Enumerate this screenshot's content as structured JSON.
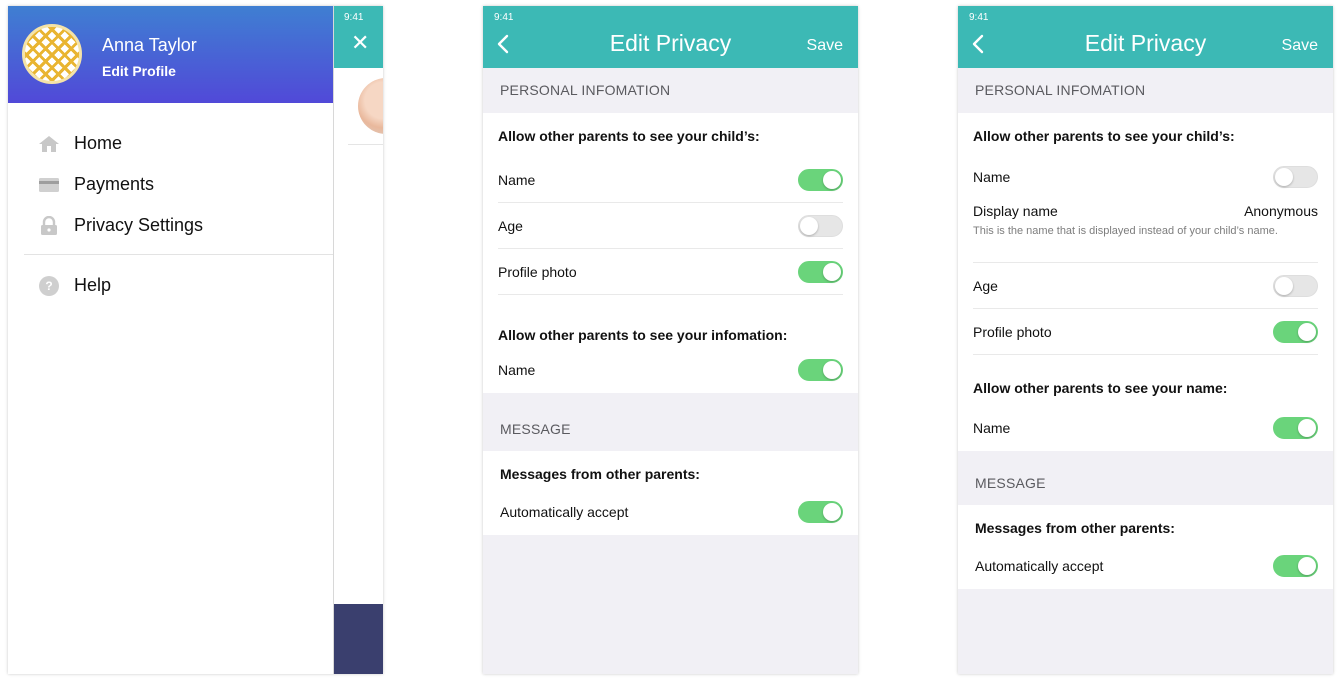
{
  "drawer_screen": {
    "status_time": "9:41",
    "user": {
      "name": "Anna Taylor",
      "edit_profile": "Edit Profile"
    },
    "menu": [
      {
        "label": "Home",
        "icon": "home-icon"
      },
      {
        "label": "Payments",
        "icon": "card-icon"
      },
      {
        "label": "Privacy Settings",
        "icon": "lock-icon"
      }
    ],
    "help": {
      "label": "Help",
      "icon": "help-icon",
      "glyph": "?"
    }
  },
  "privacy_screen_a": {
    "status_time": "9:41",
    "title": "Edit Privacy",
    "save_label": "Save",
    "personal_section": "PERSONAL INFOMATION",
    "child_subhead": "Allow other parents to see your child’s:",
    "child_rows": [
      {
        "label": "Name",
        "on": true
      },
      {
        "label": "Age",
        "on": false
      },
      {
        "label": "Profile photo",
        "on": true
      }
    ],
    "info_subhead": "Allow other parents to see your infomation:",
    "info_rows": [
      {
        "label": "Name",
        "on": true
      }
    ],
    "message_section": "MESSAGE",
    "messages_subhead": "Messages from other parents:",
    "message_rows": [
      {
        "label": "Automatically accept",
        "on": true
      }
    ]
  },
  "privacy_screen_b": {
    "status_time": "9:41",
    "title": "Edit Privacy",
    "save_label": "Save",
    "personal_section": "PERSONAL INFOMATION",
    "child_subhead": "Allow other parents to see your child’s:",
    "name_row": {
      "label": "Name",
      "on": false
    },
    "display_name": {
      "label": "Display name",
      "value": "Anonymous",
      "note": "This is the name that is displayed instead of your child’s name."
    },
    "child_rows": [
      {
        "label": "Age",
        "on": false
      },
      {
        "label": "Profile photo",
        "on": true
      }
    ],
    "name_subhead": "Allow other parents to see your name:",
    "name_rows": [
      {
        "label": "Name",
        "on": true
      }
    ],
    "message_section": "MESSAGE",
    "messages_subhead": "Messages from other parents:",
    "message_rows": [
      {
        "label": "Automatically accept",
        "on": true
      }
    ]
  },
  "colors": {
    "nav_teal": "#3cb9b5",
    "toggle_on": "#6ad47b",
    "drawer_gradient_top": "#3f7fd2",
    "drawer_gradient_bottom": "#5149d8"
  }
}
